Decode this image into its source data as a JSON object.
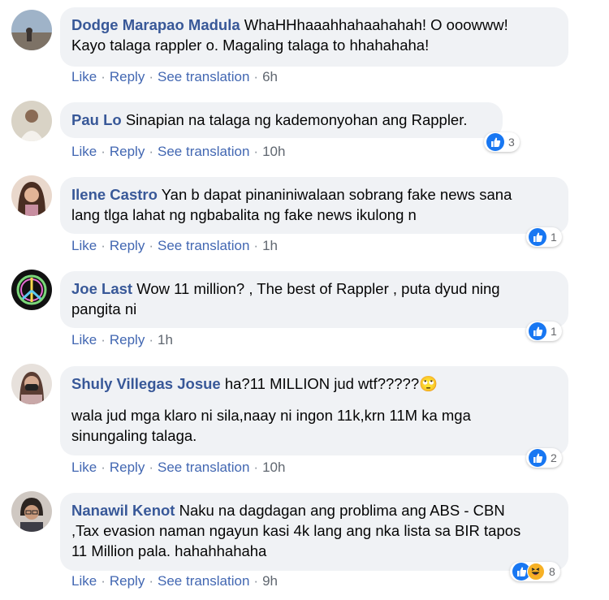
{
  "actions": {
    "like": "Like",
    "reply": "Reply",
    "see_translation": "See translation",
    "separator": "·"
  },
  "colors": {
    "name": "#385898",
    "bubble": "#f0f2f5",
    "link": "#4267b2",
    "like": "#1877f2",
    "haha": "#f7b125"
  },
  "comments": [
    {
      "author": "Dodge Marapao Madula",
      "text": "WhaHHhaaahhahaahahah! O ooowww!\nKayo talaga rappler o. Magaling talaga to hhahahaha!",
      "time": "6h",
      "reactions": "",
      "reaction_icons": []
    },
    {
      "author": "Pau Lo",
      "text": "Sinapian na talaga ng kademonyohan ang Rappler.",
      "time": "10h",
      "reactions": "3",
      "reaction_icons": [
        "like-icon"
      ]
    },
    {
      "author": "Ilene Castro",
      "text": "Yan b dapat pinaniniwalaan sobrang fake news sana\nlang tlga lahat ng ngbabalita ng fake news ikulong n",
      "time": "1h",
      "reactions": "1",
      "reaction_icons": [
        "like-icon"
      ]
    },
    {
      "author": "Joe Last",
      "text": "Wow 11 million? , The best of Rappler , puta dyud ning\npangita ni",
      "time": "1h",
      "reactions": "1",
      "reaction_icons": [
        "like-icon"
      ]
    },
    {
      "author": "Shuly Villegas Josue",
      "text": "ha?11 MILLION jud wtf?????🙄",
      "text2": "wala jud mga klaro ni sila,naay ni ingon 11k,krn 11M ka mga\nsinungaling talaga.",
      "time": "10h",
      "reactions": "2",
      "reaction_icons": [
        "like-icon"
      ]
    },
    {
      "author": "Nanawil Kenot",
      "text": "Naku na dagdagan ang problima ang ABS - CBN\n,Tax evasion naman ngayun kasi 4k lang ang nka lista sa BIR tapos\n11 Million pala. hahahhahaha",
      "time": "9h",
      "reactions": "8",
      "reaction_icons": [
        "like-icon",
        "haha-icon"
      ]
    }
  ]
}
